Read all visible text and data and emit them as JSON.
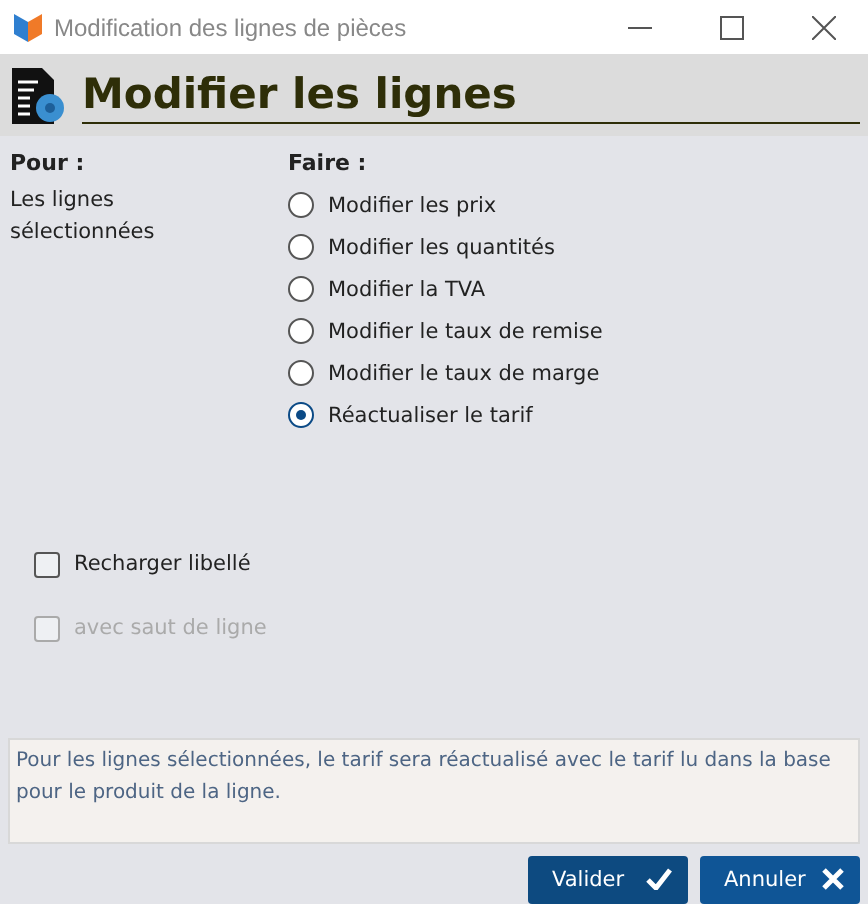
{
  "window": {
    "title": "Modification des lignes de pièces"
  },
  "header": {
    "title": "Modifier les lignes"
  },
  "pour": {
    "label": "Pour :",
    "value": "Les lignes sélectionnées"
  },
  "faire": {
    "label": "Faire :",
    "options": [
      {
        "label": "Modifier les prix",
        "selected": false
      },
      {
        "label": "Modifier les quantités",
        "selected": false
      },
      {
        "label": "Modifier la TVA",
        "selected": false
      },
      {
        "label": "Modifier le taux de remise",
        "selected": false
      },
      {
        "label": "Modifier le taux de marge",
        "selected": false
      },
      {
        "label": "Réactualiser le tarif",
        "selected": true
      }
    ]
  },
  "checkboxes": [
    {
      "label": "Recharger libellé",
      "checked": false,
      "disabled": false
    },
    {
      "label": "avec saut de ligne",
      "checked": false,
      "disabled": true
    }
  ],
  "info": "Pour les lignes sélectionnées, le tarif sera réactualisé avec le tarif lu dans la base pour le produit de la ligne.",
  "buttons": [
    {
      "label": "Valider",
      "kind": "ok"
    },
    {
      "label": "Annuler",
      "kind": "cancel"
    }
  ]
}
